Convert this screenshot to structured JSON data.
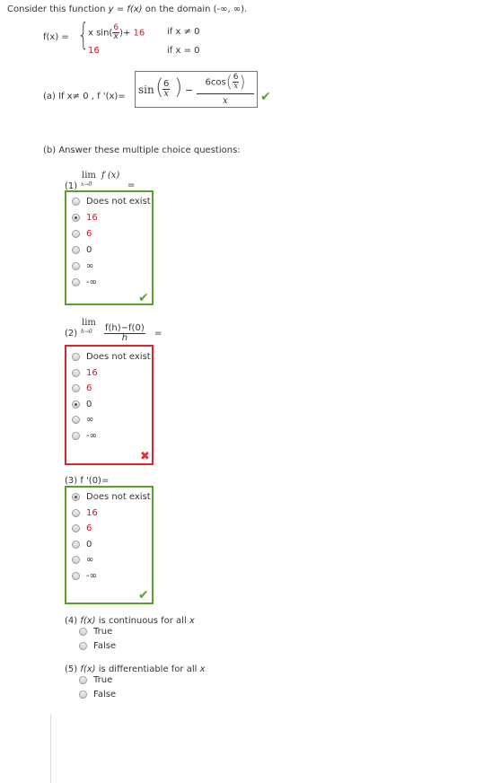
{
  "header": {
    "intro_prefix": "Consider this function ",
    "intro_func": "y = f(x)",
    "intro_suffix": " on the domain (-∞, ∞)."
  },
  "definition": {
    "lhs": "f(x) =",
    "case1_x": "x sin(",
    "case1_num": "6",
    "case1_den": "x",
    "case1_tail": ")+",
    "case1_const": "16",
    "case1_cond": "if x ≠ 0",
    "case2_value": "16",
    "case2_cond": "if x = 0"
  },
  "part_a": {
    "label": "(a) If  x≠ 0 , f '(x)=",
    "sin_word": "sin",
    "frac_num": "6",
    "frac_den": "x",
    "minus": "−",
    "num_coef": "6",
    "num_func": "cos",
    "num_frac_num": "6",
    "num_frac_den": "x",
    "den": "x"
  },
  "part_b": {
    "heading": "(b) Answer these multiple choice questions:"
  },
  "q1": {
    "num": "(1)",
    "lim": "lim",
    "sub": "x→0",
    "expr": "f (x)",
    "eq": "=",
    "options": [
      "Does not exist",
      "16",
      "6",
      "0",
      "∞",
      "-∞"
    ],
    "selected": 1
  },
  "q2": {
    "num": "(2)",
    "lim": "lim",
    "sub": "h→0",
    "numerator": "f(h)−f(0)",
    "denominator": "h",
    "eq": "=",
    "options": [
      "Does not exist",
      "16",
      "6",
      "0",
      "∞",
      "-∞"
    ],
    "selected": 3
  },
  "q3": {
    "label": "(3) f '(0)=",
    "options": [
      "Does not exist",
      "16",
      "6",
      "0",
      "∞",
      "-∞"
    ],
    "selected": 0
  },
  "q4": {
    "prefix": "(4) ",
    "func": "f(x)",
    "middle": " is continuous for all ",
    "var": "x",
    "options": [
      "True",
      "False"
    ]
  },
  "q5": {
    "prefix": "(5) ",
    "func": "f(x)",
    "middle": " is differentiable for all ",
    "var": "x",
    "options": [
      "True",
      "False"
    ]
  },
  "icons": {
    "correct": "check-mark-icon",
    "incorrect": "x-mark-icon"
  },
  "colors": {
    "correct": "#5aa02c",
    "incorrect": "#d9262c",
    "highlight_text": "#e0131a"
  }
}
